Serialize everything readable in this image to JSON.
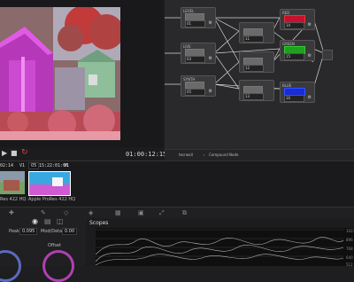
{
  "viewer": {
    "current_timecode": "01:00:12:15"
  },
  "clips": {
    "items": [
      {
        "timecode": "02:14",
        "track": "V1",
        "codec": "Res 422 HQ"
      },
      {
        "number": "05",
        "timecode": "15:22:01:06",
        "track": "V1",
        "codec": "Apple ProRes 422 HQ"
      }
    ]
  },
  "nodes": {
    "footer_left": "tecrwall",
    "footer_right": "Compound Node",
    "items": [
      {
        "label": "LEVEL",
        "num": "01"
      },
      {
        "label": "LIVE",
        "num": "03"
      },
      {
        "label": "SYNTH",
        "num": "05"
      },
      {
        "label": "",
        "num": "11"
      },
      {
        "label": "",
        "num": "12"
      },
      {
        "label": "",
        "num": "13"
      },
      {
        "label": "RED",
        "num": "14"
      },
      {
        "label": "GREEN",
        "num": "15"
      },
      {
        "label": "BLUE",
        "num": "16"
      }
    ],
    "colors": {
      "red": "#c8102e",
      "green": "#1fa01f",
      "blue": "#1a2bd8"
    }
  },
  "wheels": {
    "fields": [
      {
        "label": "Peak",
        "value": "0.095"
      },
      {
        "label": "Mod/Detail",
        "value": "0.00"
      }
    ],
    "offset_label": "Offset"
  },
  "scopes": {
    "title": "Scopes",
    "ticks": [
      "1023",
      "896",
      "768",
      "640",
      "512"
    ]
  }
}
